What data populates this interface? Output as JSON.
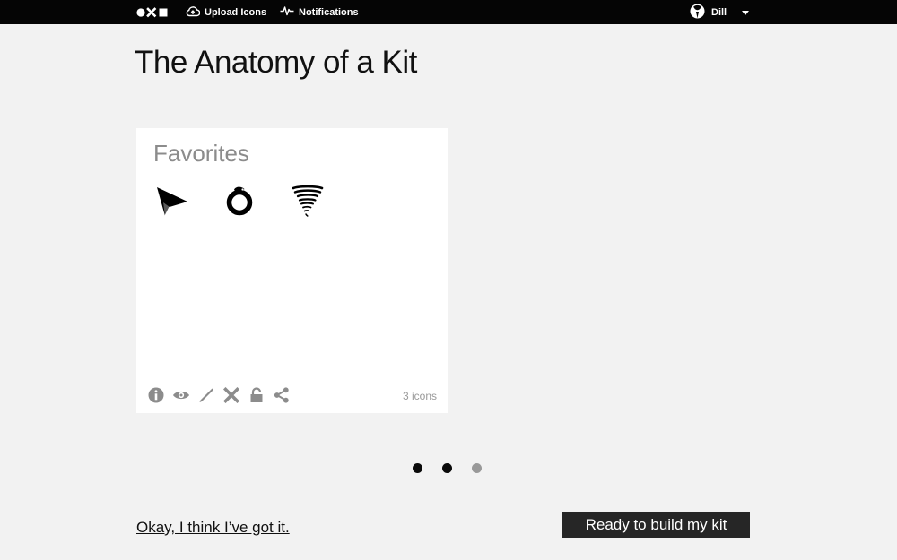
{
  "header": {
    "logo_icon": "circle-x-square-logo",
    "nav": [
      {
        "label": "Upload Icons",
        "icon": "cloud-upload-icon"
      },
      {
        "label": "Notifications",
        "icon": "activity-pulse-icon"
      }
    ],
    "user": {
      "name": "Dill",
      "avatar_icon": "user-avatar-icon",
      "menu_icon": "caret-down-icon"
    }
  },
  "page": {
    "title": "The Anatomy of a Kit"
  },
  "kit": {
    "name": "Favorites",
    "icons": [
      {
        "name": "paper-plane-icon"
      },
      {
        "name": "ouroboros-ring-icon"
      },
      {
        "name": "tornado-icon"
      }
    ],
    "actions": [
      {
        "name": "info-icon"
      },
      {
        "name": "eye-icon"
      },
      {
        "name": "pencil-icon"
      },
      {
        "name": "delete-icon"
      },
      {
        "name": "lock-icon"
      },
      {
        "name": "share-icon"
      }
    ],
    "count_label": "3 icons"
  },
  "pager": {
    "total": 3,
    "active_index": 2,
    "dot_colors": {
      "active": "#0a0a0a",
      "inactive": "#999999"
    }
  },
  "footer": {
    "dismiss_label": "Okay, I think I’ve got it.",
    "build_label": "Ready to build my kit"
  },
  "colors": {
    "topbar_bg": "#050505",
    "page_bg": "#f2f2f2",
    "card_bg": "#ffffff",
    "muted_text": "#8c8c8c",
    "action_icon": "#8c8c8c",
    "button_bg": "#262626"
  }
}
